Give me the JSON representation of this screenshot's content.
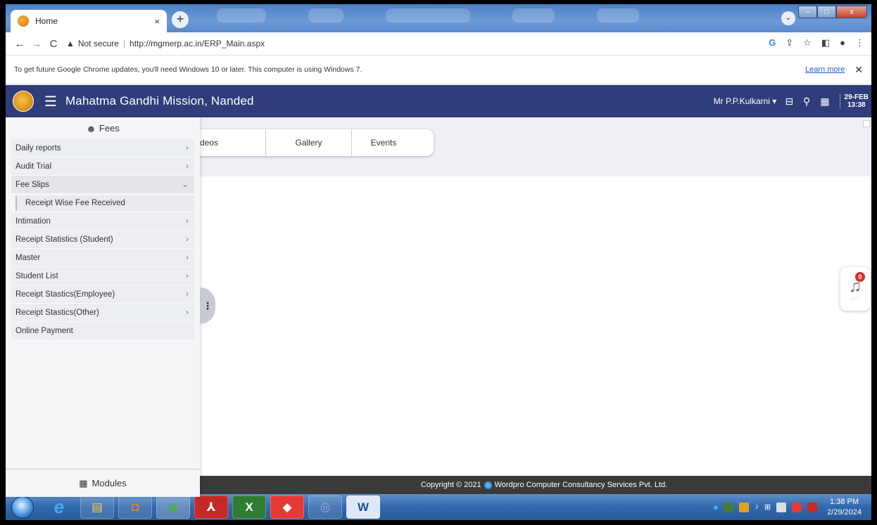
{
  "browser": {
    "tab_title": "Home",
    "tab_close": "×",
    "new_tab": "+",
    "window_dropdown": "⌄",
    "win_min": "–",
    "win_max": "□",
    "win_close": "x",
    "security_label": "Not secure",
    "url": "http://mgmerp.ac.in/ERP_Main.aspx"
  },
  "infobar": {
    "message": "To get future Google Chrome updates, you'll need Windows 10 or later. This computer is using Windows 7.",
    "link": "Learn more",
    "close": "✕"
  },
  "header": {
    "title": "Mahatma Gandhi Mission, Nanded",
    "user": "Mr P.P.Kulkarni ▾",
    "date_top": "29-FEB",
    "date_bottom": "13:38"
  },
  "sidebar": {
    "heading": "Fees",
    "items": [
      {
        "label": "Daily reports",
        "chevron": "›"
      },
      {
        "label": "Audit Trial",
        "chevron": "›"
      },
      {
        "label": "Fee Slips",
        "chevron": "⌄"
      },
      {
        "label": "Intimation",
        "chevron": "›"
      },
      {
        "label": "Receipt Statistics (Student)",
        "chevron": "›"
      },
      {
        "label": "Master",
        "chevron": "›"
      },
      {
        "label": "Student List",
        "chevron": "›"
      },
      {
        "label": "Receipt Stastics(Employee)",
        "chevron": "›"
      },
      {
        "label": "Receipt Stastics(Other)",
        "chevron": "›"
      },
      {
        "label": "Online Payment"
      }
    ],
    "subitems": [
      {
        "label": "Receipt Wise Fee Received"
      }
    ],
    "footer": "Modules",
    "handle": "⋮"
  },
  "content_tabs": [
    {
      "label": "deos"
    },
    {
      "label": "Gallery"
    },
    {
      "label": "Events"
    }
  ],
  "notifications": {
    "count": "0",
    "dots": "::::"
  },
  "footer": {
    "copyright": "Copyright © 2021",
    "company": "Wordpro Computer Consultancy Services Pvt. Ltd."
  },
  "taskbar": {
    "time": "1:38 PM",
    "date": "2/29/2024"
  }
}
